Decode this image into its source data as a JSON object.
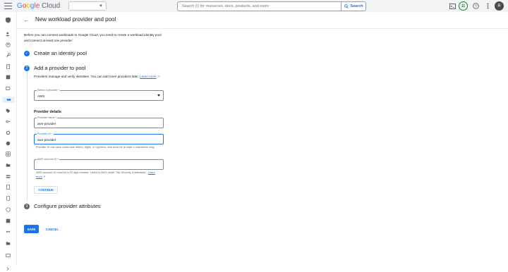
{
  "app": {
    "brand": [
      "G",
      "o",
      "o",
      "g",
      "l",
      "e"
    ],
    "product": "Cloud"
  },
  "search": {
    "placeholder": "Search (/) for resources, docs, products, and more",
    "button_label": "Search"
  },
  "account": {
    "badge": "11",
    "avatar_initial": "R"
  },
  "page": {
    "title": "New workload provider and pool",
    "intro": "Before you can connect workloads to Google Cloud, you need to create a workload identity pool and connect at least one provider:"
  },
  "steps": [
    {
      "number": "✓",
      "title": "Create an identity pool"
    },
    {
      "number": "2",
      "title": "Add a provider to pool"
    },
    {
      "number": "3",
      "title": "Configure provider attributes"
    }
  ],
  "provider_step": {
    "description": "Providers manage and verify identities. You can add more providers later.",
    "learn_more": "Learn more",
    "select_provider_label": "Select a provider *",
    "select_provider_value": "AWS",
    "details_heading": "Provider details",
    "provider_name_label": "Provider name *",
    "provider_name_value": "aws-provider",
    "provider_id_label": "Provider ID *",
    "provider_id_value": "aws-provider",
    "provider_id_hint": "Provider ID can have lowercase letters, digits, or hyphens, and must be at least 4 characters long.",
    "aws_account_label": "AWS account ID *",
    "aws_account_value": "",
    "aws_account_hint": "AWS account ID must be a 12-digit number. Listed in AWS under \"My Security Credentials\".",
    "aws_learn_more": "Learn more",
    "continue_label": "CONTINUE"
  },
  "actions": {
    "save": "SAVE",
    "cancel": "CANCEL"
  },
  "colors": {
    "accent": "#1a73e8",
    "topbar": "#f1f3f4"
  }
}
